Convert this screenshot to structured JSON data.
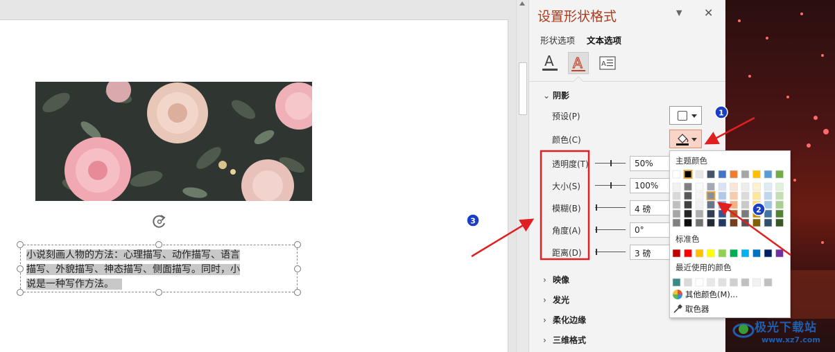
{
  "pane": {
    "title": "设置形状格式",
    "tabs": [
      "形状选项",
      "文本选项"
    ],
    "icons": [
      "text-fill-icon",
      "text-effects-icon",
      "text-layout-icon"
    ]
  },
  "shadow": {
    "header": "阴影",
    "preset_label": "预设(P)",
    "color_label": "颜色(C)",
    "transparency_label": "透明度(T)",
    "transparency_value": "50%",
    "size_label": "大小(S)",
    "size_value": "100%",
    "blur_label": "模糊(B)",
    "blur_value": "4 磅",
    "angle_label": "角度(A)",
    "angle_value": "0°",
    "distance_label": "距离(D)",
    "distance_value": "3 磅"
  },
  "collapsed_sections": [
    "映像",
    "发光",
    "柔化边缘",
    "三维格式"
  ],
  "color_popup": {
    "theme_header": "主题颜色",
    "standard_header": "标准色",
    "recent_header": "最近使用的颜色",
    "more_colors": "其他颜色(M)...",
    "eyedropper": "取色器",
    "theme_top": [
      "#ffffff",
      "#000000",
      "#e7e6e6",
      "#44546a",
      "#4472c4",
      "#ed7d31",
      "#a5a5a5",
      "#ffc000",
      "#5b9bd5",
      "#70ad47"
    ],
    "standard": [
      "#c00000",
      "#ff0000",
      "#ffc000",
      "#ffff00",
      "#92d050",
      "#00b050",
      "#00b0f0",
      "#0070c0",
      "#002060",
      "#7030a0"
    ],
    "recent": [
      "#3b8a86",
      "#d9d9d9",
      "#ffffff",
      "#e8e8e8",
      "#e0e0e0",
      "#d0d0d0",
      "#c0c0c0",
      "#f2f2f2",
      "#bfbfbf"
    ]
  },
  "slide": {
    "textbox_lines": [
      "小说刻画人物的方法：心理描写、动作描写、语言",
      "描写、外貌描写、神态描写、侧面描写。同时，小",
      "说是一种写作方法。"
    ]
  },
  "annotations": [
    "1",
    "2",
    "3"
  ],
  "watermark": {
    "name": "极光下载站",
    "url": "www.xz7.com"
  }
}
